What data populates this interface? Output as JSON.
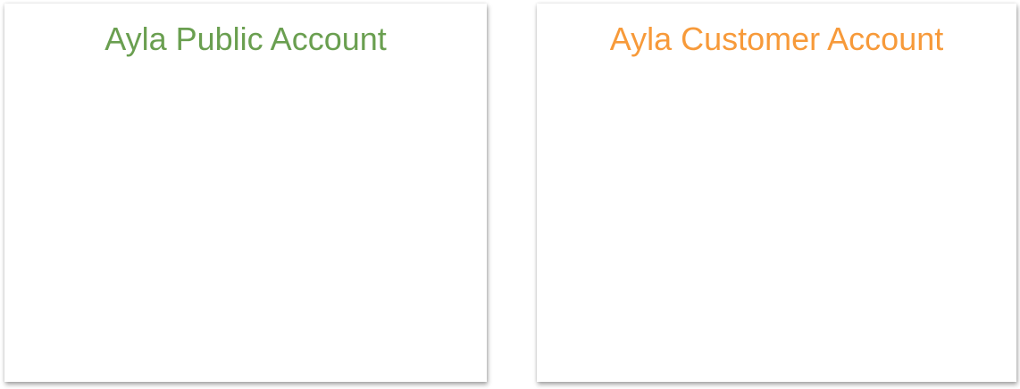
{
  "panels": [
    {
      "title": "Ayla Public Account",
      "color": "#6a9f50"
    },
    {
      "title": "Ayla Customer Account",
      "color": "#f79a3a"
    }
  ]
}
